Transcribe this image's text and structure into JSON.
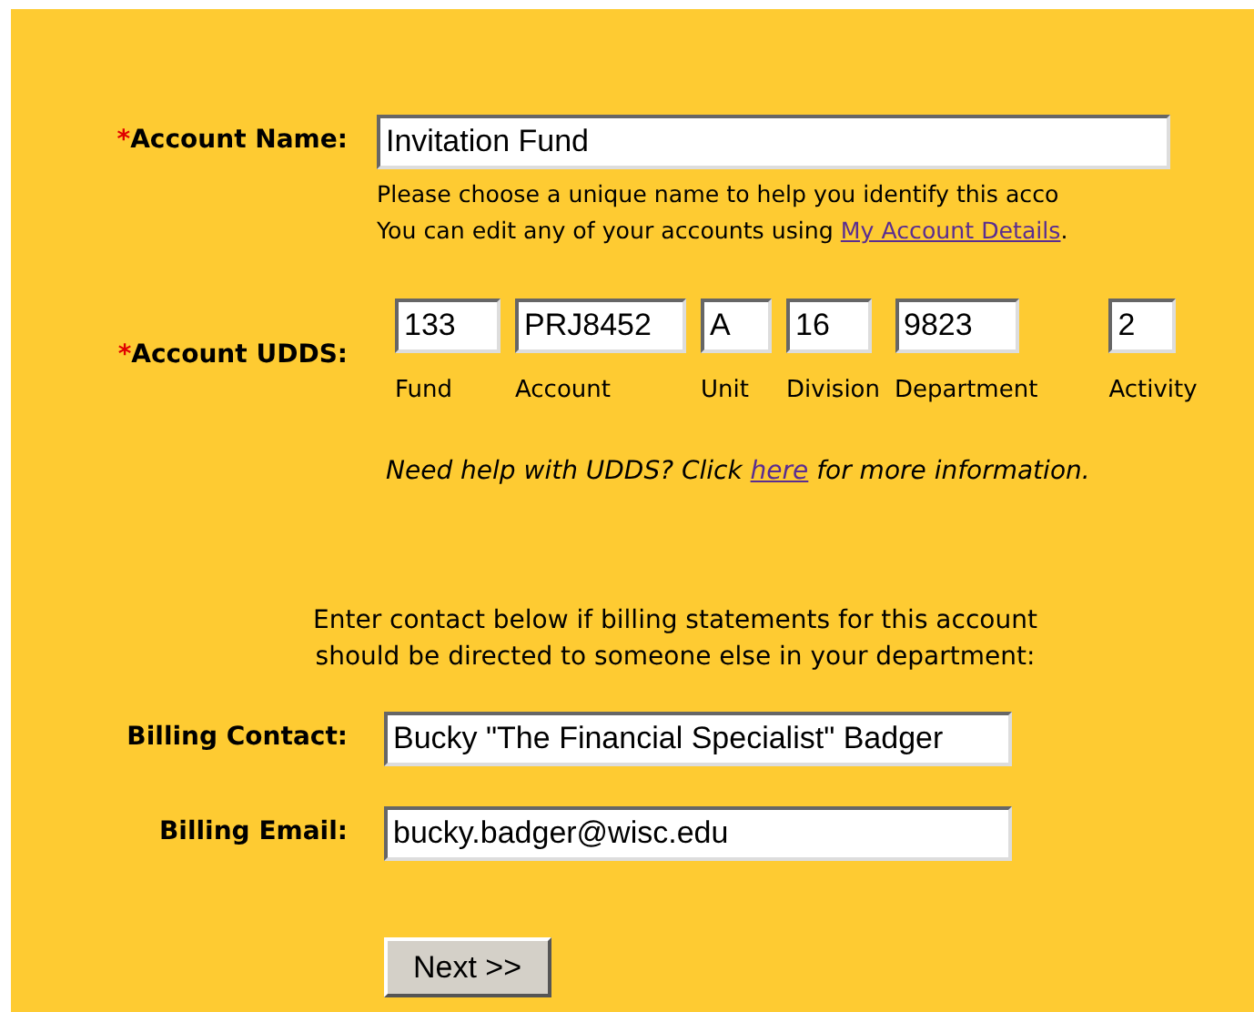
{
  "account_name": {
    "required_mark": "*",
    "label": "Account Name:",
    "value": "Invitation Fund",
    "hint_line_1": "Please choose a unique name to help you identify this acco",
    "hint_line_2_before": "You can edit any of your accounts using ",
    "hint_link": "My Account Details",
    "hint_line_2_after": "."
  },
  "udds": {
    "required_mark": "*",
    "label": "Account UDDS:",
    "fields": [
      {
        "value": "133",
        "caption": "Fund"
      },
      {
        "value": "PRJ8452",
        "caption": "Account"
      },
      {
        "value": "A",
        "caption": "Unit"
      },
      {
        "value": "16",
        "caption": "Division"
      },
      {
        "value": "9823",
        "caption": "Department"
      },
      {
        "value": "2",
        "caption": "Activity"
      }
    ],
    "help_before": "Need help with UDDS? Click ",
    "help_link": "here",
    "help_after": " for more information."
  },
  "contact_note_1": "Enter contact below if billing statements for this account",
  "contact_note_2": "should be directed to someone else in your department:",
  "billing_contact": {
    "label": "Billing Contact:",
    "value": "Bucky \"The Financial Specialist\" Badger"
  },
  "billing_email": {
    "label": "Billing Email:",
    "value": "bucky.badger@wisc.edu"
  },
  "next_button": "Next >>"
}
